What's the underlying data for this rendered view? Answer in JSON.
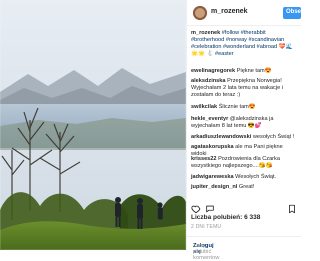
{
  "header": {
    "username": "m_rozenek",
    "follow_label": "Obse"
  },
  "comments": [
    {
      "user": "m_rozenek",
      "text": "#follow #therabbit #brotherhood #norway #scandinavian #celebration #wonderland #abroad 💝🌊 🌟🌟 🐇 #easter"
    },
    {
      "user": "ewelinagregorek",
      "text": "Piękne tam😍"
    },
    {
      "user": "aleksdzinska",
      "text": "Przepiękna Norwegia! Wyjechałam 2 lata temu na wakacje i zostałam do teraz :)"
    },
    {
      "user": "swilkcilak",
      "text": "Ślicznie tam😍"
    },
    {
      "user": "hekle_eventyr",
      "text": "@aleksdzinska ja wyjechałam 8 lat temu 😎💕"
    },
    {
      "user": "arkadiuszlewandowski",
      "text": "wesołych Świąt !"
    },
    {
      "user": "agataskorupska",
      "text": "ale ma Pani piękne widoki"
    },
    {
      "user": "krisses22",
      "text": "Pozdrowienia dla Czarka wszystkiego najlepszego....😘😘"
    },
    {
      "user": "jadwigareweska",
      "text": "Wesołych Świąt."
    },
    {
      "user": "jupiter_design_nl",
      "text": "Great!"
    }
  ],
  "likes": {
    "label": "Liczba polubień: 6 338"
  },
  "time": "2 DNI TEMU",
  "login_bar": {
    "login_link": "Zaloguj się",
    "text": ", aby polubić komentow"
  },
  "colors": {
    "accent": "#3897f0",
    "link": "#003569",
    "text": "#262626",
    "muted": "#999999",
    "border": "#efefef"
  }
}
